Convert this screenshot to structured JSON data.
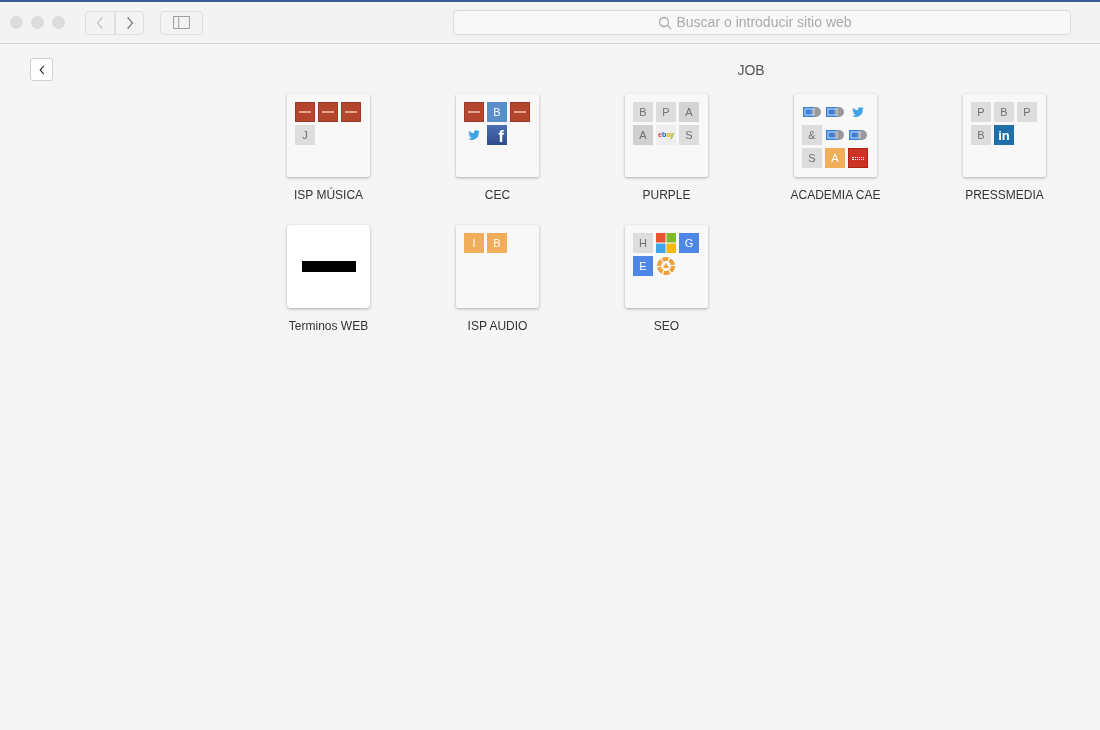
{
  "toolbar": {
    "search": {
      "placeholder": "Buscar o introducir sitio web"
    }
  },
  "folder": {
    "title": "JOB"
  },
  "tiles": [
    {
      "label": "ISP MÚSICA",
      "kind": "group",
      "items": [
        {
          "kind": "thumb"
        },
        {
          "kind": "thumb"
        },
        {
          "kind": "thumb"
        },
        {
          "kind": "letter",
          "text": "J",
          "color": "#dddddd"
        }
      ]
    },
    {
      "label": "CEC",
      "kind": "group",
      "items": [
        {
          "kind": "thumb"
        },
        {
          "kind": "letter",
          "text": "B",
          "color": "#5b8dc9"
        },
        {
          "kind": "thumb"
        },
        {
          "kind": "twitter"
        },
        {
          "kind": "facebook",
          "text": "f"
        }
      ]
    },
    {
      "label": "PURPLE",
      "kind": "group",
      "items": [
        {
          "kind": "letter",
          "text": "B",
          "color": "#dddddd"
        },
        {
          "kind": "letter",
          "text": "P",
          "color": "#dddddd"
        },
        {
          "kind": "letter",
          "text": "A",
          "color": "#d4d4d4"
        },
        {
          "kind": "letter",
          "text": "A",
          "color": "#d0d0d0"
        },
        {
          "kind": "ebay",
          "text": "ebay"
        },
        {
          "kind": "letter",
          "text": "S",
          "color": "#dddddd"
        }
      ]
    },
    {
      "label": "ACADEMIA CAE",
      "kind": "group",
      "items": [
        {
          "kind": "badge"
        },
        {
          "kind": "badge"
        },
        {
          "kind": "twitter"
        },
        {
          "kind": "letter",
          "text": "&",
          "color": "#dddddd"
        },
        {
          "kind": "badge"
        },
        {
          "kind": "badge"
        },
        {
          "kind": "letter",
          "text": "S",
          "color": "#dddddd"
        },
        {
          "kind": "letter",
          "text": "A",
          "color": "#f0ad5a"
        },
        {
          "kind": "dots"
        }
      ]
    },
    {
      "label": "PRESSMEDIA",
      "kind": "group",
      "items": [
        {
          "kind": "letter",
          "text": "P",
          "color": "#dddddd"
        },
        {
          "kind": "letter",
          "text": "B",
          "color": "#dddddd"
        },
        {
          "kind": "letter",
          "text": "P",
          "color": "#dddddd"
        },
        {
          "kind": "letter",
          "text": "B",
          "color": "#dddddd"
        },
        {
          "kind": "linkedin",
          "text": "in"
        }
      ]
    },
    {
      "label": "Terminos WEB",
      "kind": "page"
    },
    {
      "label": "ISP AUDIO",
      "kind": "group",
      "items": [
        {
          "kind": "letter",
          "text": "I",
          "color": "#f0ad5a"
        },
        {
          "kind": "letter",
          "text": "B",
          "color": "#f0ad5a"
        }
      ]
    },
    {
      "label": "SEO",
      "kind": "group",
      "items": [
        {
          "kind": "letter",
          "text": "H",
          "color": "#dddddd"
        },
        {
          "kind": "windows"
        },
        {
          "kind": "letter",
          "text": "G",
          "color": "#4f87e8"
        },
        {
          "kind": "letter",
          "text": "E",
          "color": "#4f87e8"
        },
        {
          "kind": "ring"
        }
      ]
    }
  ]
}
